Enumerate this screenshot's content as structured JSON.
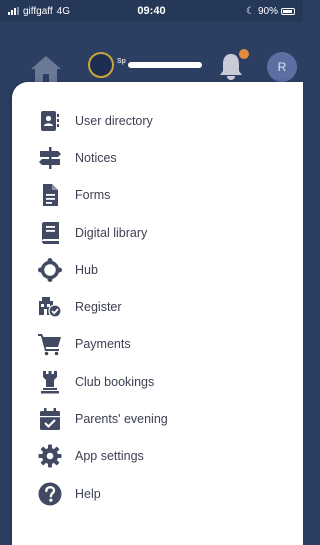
{
  "status_bar": {
    "carrier": "giffgaff",
    "network": "4G",
    "time": "09:40",
    "battery": "90%"
  },
  "header": {
    "school_name": "Sp",
    "avatar_initial": "R"
  },
  "colors": {
    "header_bg": "#2c3f63",
    "icon": "#424a63",
    "notification_dot": "#e38b3e",
    "avatar_bg": "#5c6fa3"
  },
  "menu": {
    "items": [
      {
        "label": "User directory",
        "icon": "address-book-icon"
      },
      {
        "label": "Notices",
        "icon": "signpost-icon"
      },
      {
        "label": "Forms",
        "icon": "document-icon"
      },
      {
        "label": "Digital library",
        "icon": "book-icon"
      },
      {
        "label": "Hub",
        "icon": "hub-icon"
      },
      {
        "label": "Register",
        "icon": "register-icon"
      },
      {
        "label": "Payments",
        "icon": "cart-icon"
      },
      {
        "label": "Club bookings",
        "icon": "rook-icon"
      },
      {
        "label": "Parents' evening",
        "icon": "calendar-check-icon"
      },
      {
        "label": "App settings",
        "icon": "gear-icon"
      },
      {
        "label": "Help",
        "icon": "question-circle-icon"
      }
    ]
  }
}
